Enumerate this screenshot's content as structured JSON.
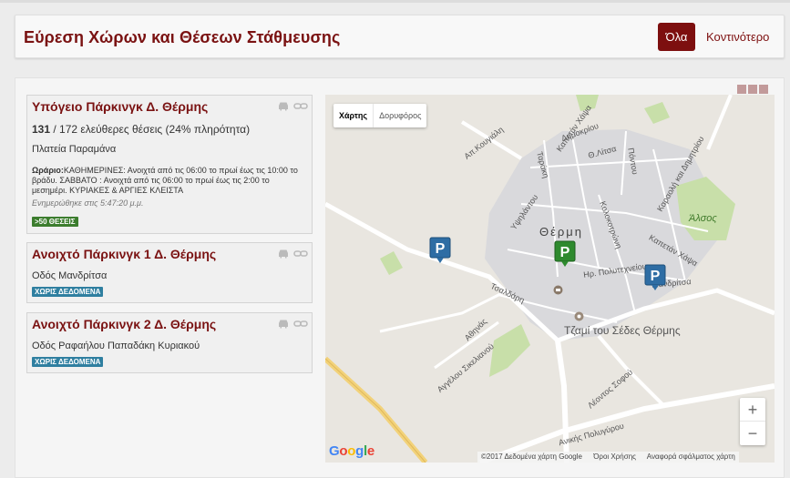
{
  "header": {
    "title": "Εύρεση Χώρων και Θέσεων Στάθμευσης",
    "btn_all": "Όλα",
    "btn_near": "Κοντινότερο"
  },
  "parkings": [
    {
      "name": "Υπόγειο Πάρκινγκ Δ. Θέρμης",
      "free": "131",
      "availability_rest": " / 172 ελεύθερες θέσεις (24% πληρότητα)",
      "address": "Πλατεία Παραμάνα",
      "hours_label": "Ωράριο:",
      "hours_text": "ΚΑΘΗΜΕΡΙΝΕΣ: Ανοιχτά από τις 06:00 το πρωί έως τις 10:00 το βράδυ. ΣΑΒΒΑΤΟ : Ανοιχτά από τις 06:00 το πρωί έως τις 2:00 το μεσημέρι. ΚΥΡΙΑΚΕΣ & ΑΡΓΙΕΣ ΚΛΕΙΣΤΑ",
      "updated": "Ενημερώθηκε στις 5:47:20 μ.μ.",
      "badge": ">50 ΘΕΣΕΙΣ",
      "badge_color": "#3c7d2e"
    },
    {
      "name": "Ανοιχτό Πάρκινγκ 1 Δ. Θέρμης",
      "address": "Οδός Μανδρίτσα",
      "badge": "ΧΩΡΙΣ ΔΕΔΟΜΕΝΑ",
      "badge_color": "#2f7fa0"
    },
    {
      "name": "Ανοιχτό Πάρκινγκ 2 Δ. Θέρμης",
      "address": "Οδός Ραφαήλου Παπαδάκη Κυριακού",
      "badge": "ΧΩΡΙΣ ΔΕΔΟΜΕΝΑ",
      "badge_color": "#2f7fa0"
    }
  ],
  "map": {
    "type_map": "Χάρτης",
    "type_satellite": "Δορυφόρος",
    "zoom_in": "+",
    "zoom_out": "−",
    "footer_data": "©2017 Δεδομένα χάρτη Google",
    "footer_terms": "Όροι Χρήσης",
    "footer_report": "Αναφορά σφάλματος χάρτη",
    "logo": "Google",
    "labels": {
      "town": "Θέρμη",
      "mosque": "Τζαμί του Σέδες Θέρμης",
      "alsos": "Άλσος",
      "s1": "Απ.Κουγιάλη",
      "s2": "Καπετάν Χάψα",
      "s3": "Δημοκρίου",
      "s4": "Θ.Λίτσα",
      "s5": "Πόντου",
      "s6": "Καραολή και Δημητρίου",
      "s7": "Ταράκη",
      "s8": "Υψηλάντου",
      "s9": "Κολοκοτρώνη",
      "s10": "Ηρ. Πολυτεχνείου",
      "s11": "Καπετάν Χάψα",
      "s12": "Μανδρίτσα",
      "s13": "Τσαλδάρη",
      "s14": "Αθηνάς",
      "s15": "Αγγέλου Σικελιανού",
      "s16": "Λέοντος Σοφού",
      "s17": "Ανικής Πολυγύρου"
    },
    "marker_letter": "P"
  },
  "colors": {
    "accent": "#7d0f0f",
    "title": "#7a1212",
    "marker_blue": "#2e6da4",
    "marker_green": "#2e8a2e"
  }
}
